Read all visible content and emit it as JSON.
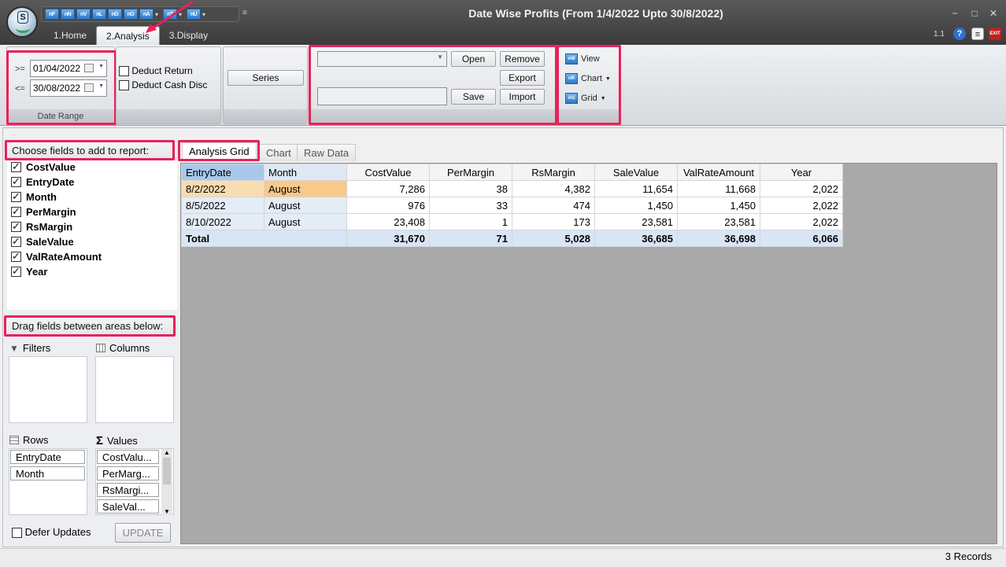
{
  "window": {
    "title": "Date Wise Profits (From 1/4/2022 Upto 30/8/2022)",
    "version": "1.1",
    "controls": {
      "minimize": "−",
      "maximize": "□",
      "close": "✕"
    }
  },
  "quick_access": [
    {
      "label": "nF",
      "icon": "f-icon"
    },
    {
      "label": "nN",
      "icon": "n-icon"
    },
    {
      "label": "nV",
      "icon": "v-icon"
    },
    {
      "label": "nL",
      "icon": "l-icon"
    },
    {
      "label": "nG",
      "icon": "g-icon"
    },
    {
      "label": "nO",
      "icon": "o-icon"
    },
    {
      "label": "nA",
      "icon": "a-icon"
    },
    {
      "label": "nT",
      "icon": "t-icon"
    },
    {
      "label": "nU",
      "icon": "u-icon"
    }
  ],
  "tabs": [
    {
      "label": "1.Home",
      "active": false
    },
    {
      "label": "2.Analysis",
      "active": true
    },
    {
      "label": "3.Display",
      "active": false
    }
  ],
  "ribbon": {
    "date_range": {
      "from_op": ">=",
      "from_value": "01/04/2022",
      "to_op": "<=",
      "to_value": "30/08/2022",
      "group_label": "Date Range"
    },
    "deduct_return": {
      "label": "Deduct Return",
      "checked": false
    },
    "deduct_cash_disc": {
      "label": "Deduct Cash Disc",
      "checked": false
    },
    "series_label": "Series",
    "layout": {
      "combo_value": "",
      "name_value": "",
      "open_label": "Open",
      "save_label": "Save",
      "remove_label": "Remove",
      "export_label": "Export",
      "import_label": "Import"
    },
    "view": {
      "view_label": "View",
      "chart_label": "Chart",
      "grid_label": "Grid"
    }
  },
  "field_chooser": {
    "title": "Choose fields to add to report:",
    "fields": [
      {
        "label": "CostValue",
        "checked": true
      },
      {
        "label": "EntryDate",
        "checked": true
      },
      {
        "label": "Month",
        "checked": true
      },
      {
        "label": "PerMargin",
        "checked": true
      },
      {
        "label": "RsMargin",
        "checked": true
      },
      {
        "label": "SaleValue",
        "checked": true
      },
      {
        "label": "ValRateAmount",
        "checked": true
      },
      {
        "label": "Year",
        "checked": true
      }
    ]
  },
  "areas": {
    "title": "Drag fields between areas below:",
    "filters_label": "Filters",
    "columns_label": "Columns",
    "rows_label": "Rows",
    "values_label": "Values",
    "rows": [
      "EntryDate",
      "Month"
    ],
    "values": [
      "CostValu...",
      "PerMarg...",
      "RsMargi...",
      "SaleVal..."
    ],
    "defer_label": "Defer Updates",
    "defer_checked": false,
    "update_label": "UPDATE"
  },
  "grid_tabs": [
    "Analysis Grid",
    "Chart",
    "Raw Data"
  ],
  "pivot": {
    "row_headers": [
      "EntryDate",
      "Month"
    ],
    "columns": [
      "CostValue",
      "PerMargin",
      "RsMargin",
      "SaleValue",
      "ValRateAmount",
      "Year"
    ],
    "rows": [
      {
        "date": "8/2/2022",
        "month": "August",
        "values": [
          "7,286",
          "38",
          "4,382",
          "11,654",
          "11,668",
          "2,022"
        ]
      },
      {
        "date": "8/5/2022",
        "month": "August",
        "values": [
          "976",
          "33",
          "474",
          "1,450",
          "1,450",
          "2,022"
        ]
      },
      {
        "date": "8/10/2022",
        "month": "August",
        "values": [
          "23,408",
          "1",
          "173",
          "23,581",
          "23,581",
          "2,022"
        ]
      }
    ],
    "total_label": "Total",
    "totals": [
      "31,670",
      "71",
      "5,028",
      "36,685",
      "36,698",
      "6,066"
    ]
  },
  "status": {
    "records": "3 Records"
  },
  "colors": {
    "highlight": "#e8215a",
    "selected_row": "#f9c98a",
    "header_blue": "#a9c7ea",
    "grid_background": "#a9a9a9"
  }
}
